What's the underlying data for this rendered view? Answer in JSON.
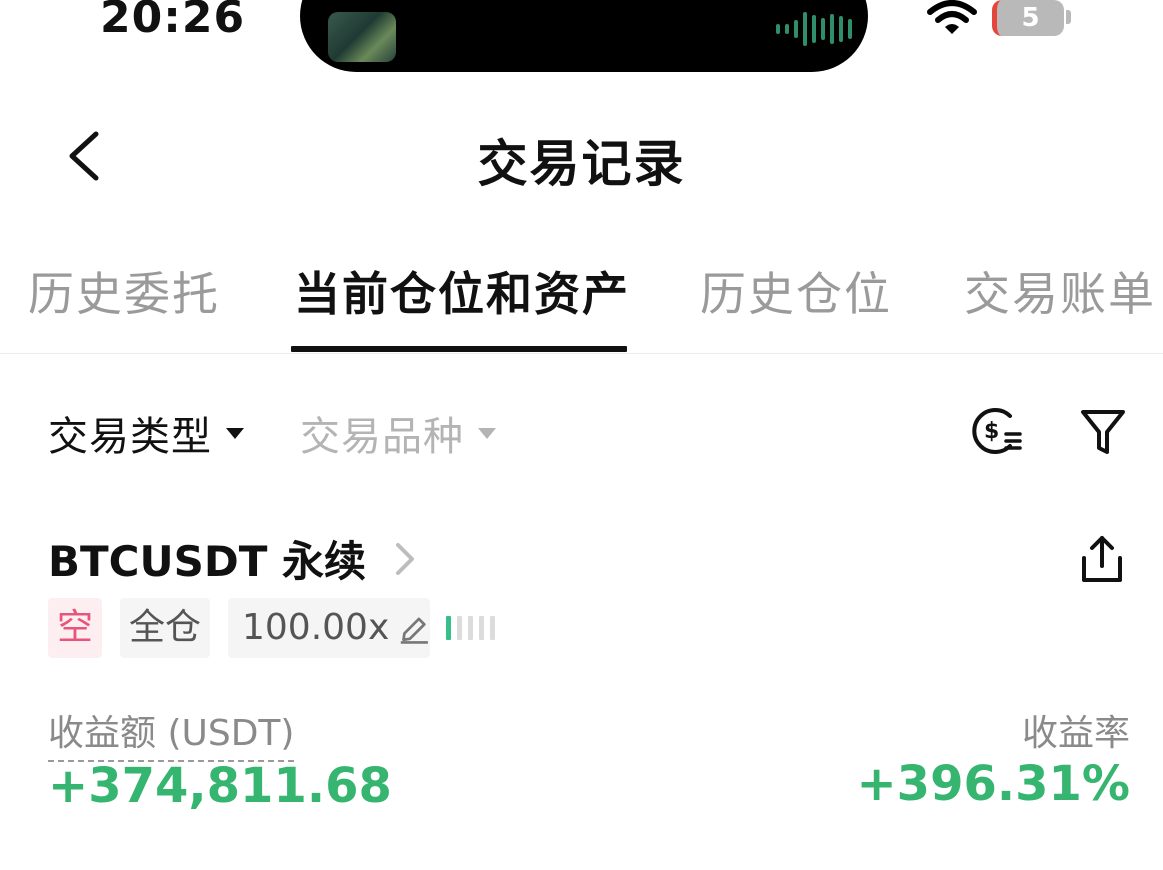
{
  "status_bar": {
    "time": "20:26",
    "battery": "5"
  },
  "header": {
    "title": "交易记录"
  },
  "tabs": [
    {
      "label": "历史委托",
      "active": false
    },
    {
      "label": "当前仓位和资产",
      "active": true
    },
    {
      "label": "历史仓位",
      "active": false
    },
    {
      "label": "交易账单",
      "active": false
    }
  ],
  "filters": {
    "type_label": "交易类型",
    "symbol_label": "交易品种"
  },
  "position": {
    "symbol": "BTCUSDT 永续",
    "side_tag": "空",
    "margin_tag": "全仓",
    "leverage": "100.00x",
    "pnl_label": "收益额 (USDT)",
    "pnl_value": "+374,811.68",
    "roe_label": "收益率",
    "roe_value": "+396.31%",
    "risk_level": 1,
    "risk_bars": 5
  },
  "colors": {
    "profit": "#35b56f",
    "short": "#e8557a",
    "risk": "#35c08a"
  },
  "icons": [
    "back-arrow-icon",
    "coin-list-icon",
    "filter-icon",
    "chevron-right-icon",
    "share-icon",
    "edit-icon",
    "wifi-icon",
    "battery-icon"
  ]
}
